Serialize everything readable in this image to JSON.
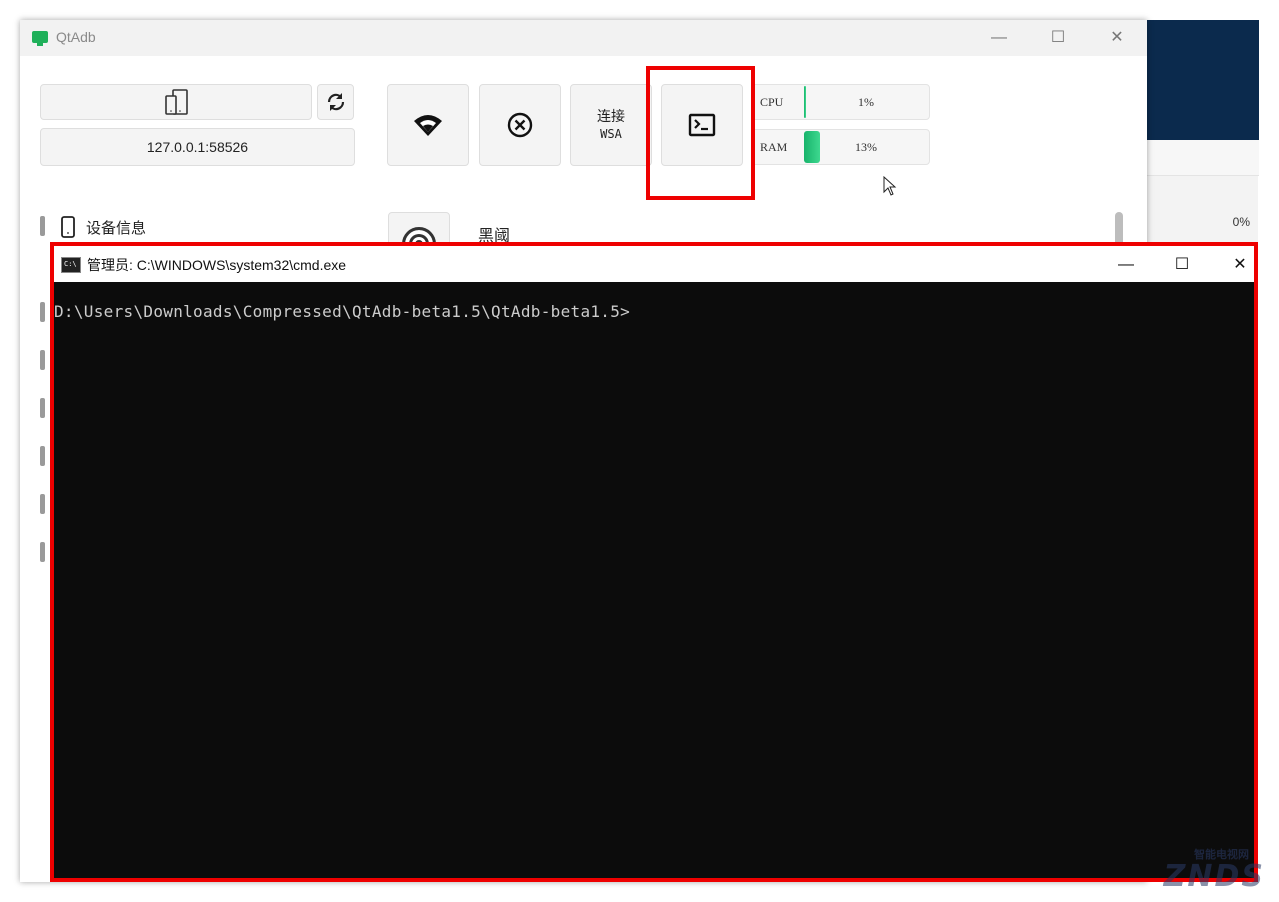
{
  "qtadb": {
    "title": "QtAdb",
    "ip": "127.0.0.1:58526",
    "wsa_label": "连接",
    "wsa_sub": "WSA",
    "cpu_label": "CPU",
    "cpu_value": "1%",
    "cpu_fraction": 0.01,
    "ram_label": "RAM",
    "ram_value": "13%",
    "ram_fraction": 0.13,
    "sidebar_item": "设备信息",
    "row_label": "黑阈"
  },
  "background_window": {
    "percent": "0%"
  },
  "cmd": {
    "title": "管理员: C:\\WINDOWS\\system32\\cmd.exe",
    "icon_text": "C:\\",
    "prompt": "D:\\Users\\Downloads\\Compressed\\QtAdb-beta1.5\\QtAdb-beta1.5>"
  },
  "watermark": {
    "text": "ZNDS",
    "sub": "智能电视网"
  },
  "colors": {
    "highlight": "#ee0000",
    "meter_fill": "#17b36b",
    "console_bg": "#0c0c0c"
  }
}
